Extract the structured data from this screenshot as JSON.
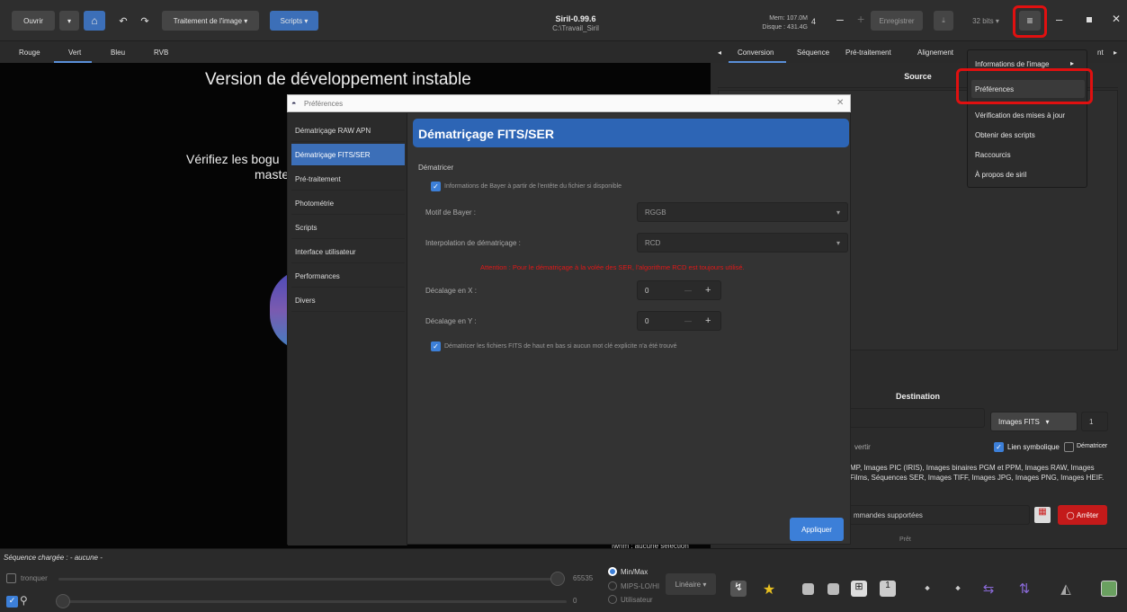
{
  "toolbar": {
    "open": "Ouvrir",
    "processing": "Traitement de l'image",
    "scripts": "Scripts",
    "app_title": "Siril-0.99.6",
    "path": "C:\\Travail_Siril",
    "mem": "Mem: 107.0M",
    "disk": "Disque : 431.4G",
    "spin_value": "4",
    "save": "Enregistrer",
    "bits": "32 bits"
  },
  "channels": [
    "Rouge",
    "Vert",
    "Bleu",
    "RVB"
  ],
  "right_tabs": [
    "Conversion",
    "Séquence",
    "Pré-traitement",
    "Alignement",
    "nt"
  ],
  "canvas": {
    "title": "Version de développement instable",
    "line1": "Vérifiez les bogu",
    "line2": "maste"
  },
  "dialog": {
    "title": "Préférences",
    "header": "Dématriçage FITS/SER",
    "section": "Dématricer",
    "opt_bayer": "Informations de Bayer à partir de l'entête du fichier si disponible",
    "bayer_label": "Motif de Bayer :",
    "bayer_value": "RGGB",
    "interp_label": "Interpolation de dématriçage :",
    "interp_value": "RCD",
    "warning": "Attention : Pour le dématriçage à la volée des SER, l'algorithme RCD est toujours utilisé.",
    "offset_x_label": "Décalage en X :",
    "offset_x": "0",
    "offset_y_label": "Décalage en Y :",
    "offset_y": "0",
    "opt_flip": "Dématricer les fichiers FITS de haut en bas si aucun mot clé explicite n'a été trouvé",
    "apply": "Appliquer",
    "sidebar": [
      "Dématriçage RAW APN",
      "Dématriçage FITS/SER",
      "Pré-traitement",
      "Photométrie",
      "Scripts",
      "Interface utilisateur",
      "Performances",
      "Divers"
    ]
  },
  "menu": {
    "items": [
      "Informations de l'image",
      "Préférences",
      "Vérification des mises à jour",
      "Obtenir des scripts",
      "Raccourcis",
      "À propos de siril"
    ]
  },
  "right_panel": {
    "source": "Source",
    "destination": "Destination",
    "format": "Images FITS",
    "count": "1",
    "convert": "vertir",
    "symlink": "Lien symbolique",
    "demat": "Dématricer",
    "formats_line1": "MP, Images PIC (IRIS), Images binaires PGM et PPM, Images RAW, Images",
    "formats_line2": "Films, Séquences SER, Images TIFF, Images JPG, Images PNG, Images HEIF.",
    "cmd_placeholder": "mmandes supportées",
    "stop": "Arrêter",
    "status": "Prêt",
    "fwhm": "fwhm : aucune sélection"
  },
  "bottom": {
    "sequence": "Séquence chargée : - aucune -",
    "trunc": "tronquer",
    "max": "65535",
    "min": "0",
    "minmax": "Min/Max",
    "mips": "MIPS-LO/HI",
    "user": "Utilisateur",
    "scale": "Linéaire"
  }
}
